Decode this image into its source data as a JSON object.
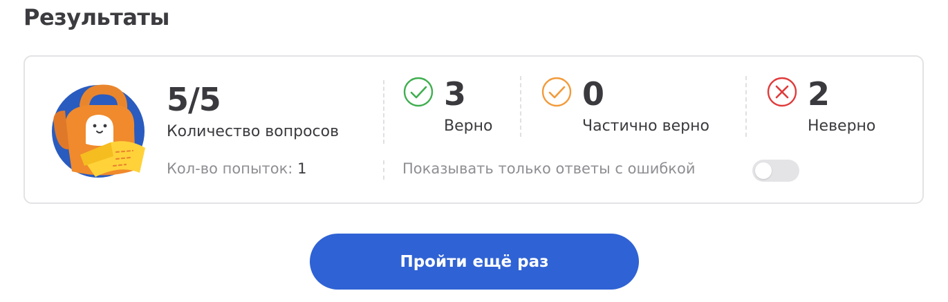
{
  "page": {
    "title": "Результаты"
  },
  "summary": {
    "count": "5/5",
    "count_label": "Количество вопросов",
    "attempts_label": "Кол-во попыток:",
    "attempts_value": "1"
  },
  "stats": [
    {
      "value": "3",
      "label": "Верно",
      "icon": "check-circle-icon",
      "color": "#3fae4f"
    },
    {
      "value": "0",
      "label": "Частично верно",
      "icon": "check-circle-icon",
      "color": "#f29a3a"
    },
    {
      "value": "2",
      "label": "Неверно",
      "icon": "cross-circle-icon",
      "color": "#e03a3a"
    }
  ],
  "filter": {
    "label": "Показывать только ответы с ошибкой",
    "enabled": false
  },
  "actions": {
    "retry_label": "Пройти ещё раз"
  },
  "colors": {
    "primary": "#2f62d4",
    "border": "#e3e3e6",
    "muted_text": "#8e8e93"
  }
}
